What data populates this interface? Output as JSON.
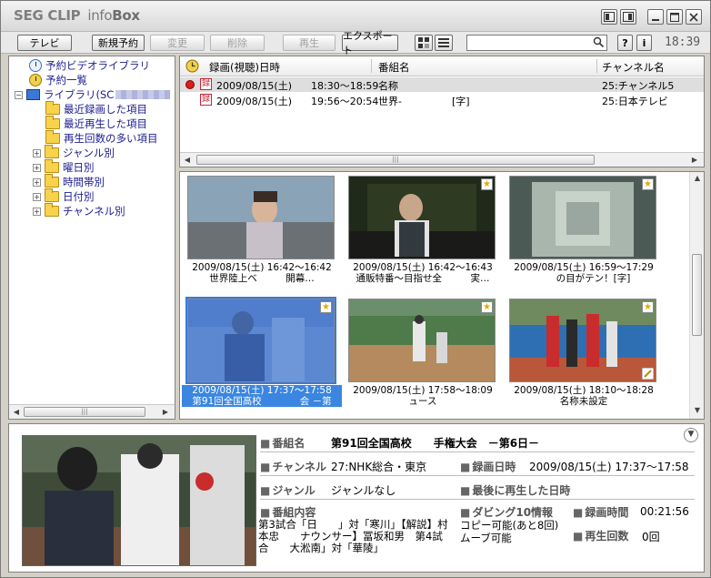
{
  "app": {
    "brand_part1": "SEG CLIP",
    "brand_part2": "info",
    "brand_part3": "Box",
    "clock": "18:39"
  },
  "toolbar": {
    "tv": "テレビ",
    "new_reservation": "新規予約",
    "change": "変更",
    "delete": "削除",
    "play": "再生",
    "export": "エクスポート",
    "search_placeholder": "",
    "help": "?",
    "info": "i"
  },
  "tree": {
    "items": [
      {
        "label": "予約ビデオライブラリ"
      },
      {
        "label": "予約一覧"
      },
      {
        "label": "ライブラリ(SC"
      },
      {
        "label": "最近録画した項目"
      },
      {
        "label": "最近再生した項目"
      },
      {
        "label": "再生回数の多い項目"
      },
      {
        "label": "ジャンル別"
      },
      {
        "label": "曜日別"
      },
      {
        "label": "時間帯別"
      },
      {
        "label": "日付別"
      },
      {
        "label": "チャンネル別"
      }
    ]
  },
  "list": {
    "headers": {
      "datetime": "録画(視聴)日時",
      "program": "番組名",
      "channel": "チャンネル名"
    },
    "rows": [
      {
        "badge": "録",
        "date": "2009/08/15(土)",
        "time": "18:30～18:59",
        "program": "名称",
        "channel": "25:チャンネル5"
      },
      {
        "badge": "録",
        "date": "2009/08/15(土)",
        "time": "19:56～20:54",
        "program": "世界-　　　　　[字]",
        "channel": "25:日本テレビ"
      }
    ]
  },
  "grid": {
    "items": [
      {
        "date": "2009/08/15(土) 16:42～16:42",
        "title": "世界陸上ベ　　　開幕…"
      },
      {
        "date": "2009/08/15(土) 16:42～16:43",
        "title": "通販特番～目指せ全　　　実…"
      },
      {
        "date": "2009/08/15(土) 16:59～17:29",
        "title": "　　の目がテン！[字]"
      },
      {
        "date": "2009/08/15(土) 17:37～17:58",
        "title": "第91回全国高校　　　　会 －第"
      },
      {
        "date": "2009/08/15(土) 17:58～18:09",
        "title": "ュース"
      },
      {
        "date": "2009/08/15(土) 18:10～18:28",
        "title": "名称未設定"
      }
    ]
  },
  "info": {
    "program_label": "番組名",
    "program_value": "第91回全国高校　　手権大会　－第6日－",
    "channel_label": "チャンネル",
    "channel_value": "27:NHK総合・東京",
    "rec_datetime_label": "録画日時",
    "rec_datetime_value": "2009/08/15(土) 17:37～17:58",
    "genre_label": "ジャンル",
    "genre_value": "ジャンルなし",
    "last_played_label": "最後に再生した日時",
    "content_label": "番組内容",
    "content_value": "第3試合「日　　」対「寒川」【解説】村本忠　　ナウンサー】冨坂和男　第4試合　　大淞南」対「華陵」",
    "dubbing_label": "ダビング10情報",
    "dubbing_value": "コピー可能(あと8回)ムーブ可能",
    "rec_time_label": "録画時間",
    "rec_time_value": "00:21:56",
    "play_count_label": "再生回数",
    "play_count_value": "0回"
  },
  "colors": {
    "selection": "#3a86e0",
    "tree_text": "#1b1b8f",
    "rec_red": "#d81e1e",
    "star": "#e8a800"
  }
}
